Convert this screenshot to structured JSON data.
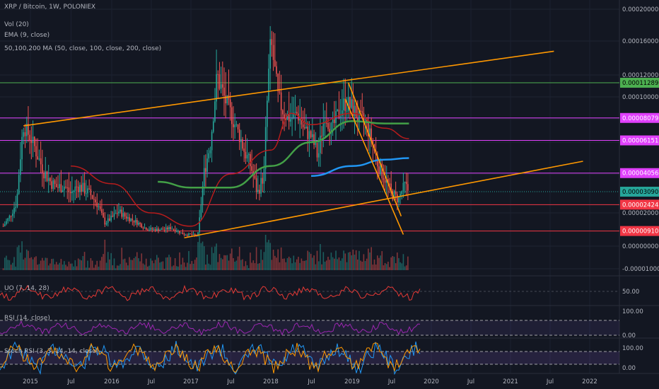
{
  "header": {
    "symbol_line": "XRP / Bitcoin, 1W, POLONIEX",
    "vol_label": "Vol (20)",
    "ema_label": "EMA (9, close)",
    "ma_label": "50,100,200 MA (50, close, 100, close, 200, close)"
  },
  "colors": {
    "background": "#131722",
    "candle_up": "#26a69a",
    "candle_down": "#ef5350",
    "trend_orange": "#ff9800",
    "ma50": "#b71c1c",
    "ma100": "#43a047",
    "ma200": "#2196f3",
    "hline_green": "#4caf50",
    "hline_magenta": "#e040fb",
    "hline_red": "#f23645",
    "osc_uo": "#e53935",
    "osc_rsi": "#9c27b0",
    "stoch_k": "#2196f3",
    "stoch_d": "#ff9800"
  },
  "chart_data": {
    "type": "candlestick",
    "x_range": [
      "2014-09-01",
      "2022-12-31"
    ],
    "y_range": [
      -1e-05,
      0.00021
    ],
    "price_axis_ticks": [
      "0.00020000",
      "0.00016000",
      "0.00012000",
      "0.00010000",
      "0.00008000",
      "0.00006000",
      "0.00004000",
      "0.00002000",
      "0.00000000",
      "-0.00001000"
    ],
    "time_axis_ticks": [
      "2015",
      "Jul",
      "2016",
      "Jul",
      "2017",
      "Jul",
      "2018",
      "Jul",
      "2019",
      "Jul",
      "2020",
      "Jul",
      "2021",
      "Jul",
      "2022"
    ],
    "horizontal_levels": [
      {
        "value": 0.00011289,
        "label": "0.00011289",
        "color": "green"
      },
      {
        "value": 8.079e-05,
        "label": "0.00008079",
        "color": "magenta"
      },
      {
        "value": 6.151e-05,
        "label": "0.00006151",
        "color": "magenta"
      },
      {
        "value": 4.056e-05,
        "label": "0.00004056",
        "color": "magenta"
      },
      {
        "value": 3.09e-05,
        "label": "0.00003090",
        "color": "last"
      },
      {
        "value": 2.424e-05,
        "label": "0.00002424",
        "color": "red"
      },
      {
        "value": 9.1e-06,
        "label": "0.00000910",
        "color": "red"
      }
    ],
    "price_series": [
      [
        "2014-09-01",
        1.2e-05
      ],
      [
        "2014-10-01",
        1.8e-05
      ],
      [
        "2014-11-01",
        2.6e-05
      ],
      [
        "2014-12-01",
        7.4e-05
      ],
      [
        "2015-01-01",
        6.4e-05
      ],
      [
        "2015-02-01",
        5.2e-05
      ],
      [
        "2015-03-01",
        4.2e-05
      ],
      [
        "2015-04-01",
        3.6e-05
      ],
      [
        "2015-05-01",
        3.3e-05
      ],
      [
        "2015-06-01",
        3.4e-05
      ],
      [
        "2015-07-01",
        3e-05
      ],
      [
        "2015-08-01",
        3.4e-05
      ],
      [
        "2015-09-01",
        3.2e-05
      ],
      [
        "2015-10-01",
        2.9e-05
      ],
      [
        "2015-11-01",
        2.4e-05
      ],
      [
        "2015-12-01",
        1.4e-05
      ],
      [
        "2016-01-01",
        1.7e-05
      ],
      [
        "2016-02-01",
        2.1e-05
      ],
      [
        "2016-03-01",
        1.8e-05
      ],
      [
        "2016-04-01",
        1.6e-05
      ],
      [
        "2016-05-01",
        1.4e-05
      ],
      [
        "2016-06-01",
        1.1e-05
      ],
      [
        "2016-07-01",
        1e-05
      ],
      [
        "2016-08-01",
        1e-05
      ],
      [
        "2016-09-01",
        1e-05
      ],
      [
        "2016-10-01",
        1.1e-05
      ],
      [
        "2016-11-01",
        9e-06
      ],
      [
        "2016-12-01",
        7e-06
      ],
      [
        "2017-01-01",
        7e-06
      ],
      [
        "2017-02-01",
        6e-06
      ],
      [
        "2017-03-01",
        4e-05
      ],
      [
        "2017-04-01",
        6e-05
      ],
      [
        "2017-05-01",
        0.00012
      ],
      [
        "2017-06-01",
        0.0001
      ],
      [
        "2017-07-01",
        8.5e-05
      ],
      [
        "2017-08-01",
        7e-05
      ],
      [
        "2017-09-01",
        5.5e-05
      ],
      [
        "2017-10-01",
        4.5e-05
      ],
      [
        "2017-11-01",
        3e-05
      ],
      [
        "2017-12-01",
        4e-05
      ],
      [
        "2018-01-01",
        0.00016
      ],
      [
        "2018-02-01",
        0.0001
      ],
      [
        "2018-03-01",
        8.5e-05
      ],
      [
        "2018-04-01",
        8e-05
      ],
      [
        "2018-05-01",
        8.5e-05
      ],
      [
        "2018-06-01",
        7e-05
      ],
      [
        "2018-07-01",
        6.5e-05
      ],
      [
        "2018-08-01",
        5e-05
      ],
      [
        "2018-09-01",
        8.5e-05
      ],
      [
        "2018-10-01",
        7e-05
      ],
      [
        "2018-11-01",
        8.5e-05
      ],
      [
        "2018-12-01",
        9.5e-05
      ],
      [
        "2019-01-01",
        9e-05
      ],
      [
        "2019-02-01",
        8e-05
      ],
      [
        "2019-03-01",
        7.8e-05
      ],
      [
        "2019-04-01",
        6.2e-05
      ],
      [
        "2019-05-01",
        4.5e-05
      ],
      [
        "2019-06-01",
        3.8e-05
      ],
      [
        "2019-07-01",
        3e-05
      ],
      [
        "2019-08-01",
        2.7e-05
      ],
      [
        "2019-09-01",
        3.4e-05
      ],
      [
        "2019-09-20",
        3.09e-05
      ]
    ],
    "ma50": [
      [
        "2015-07-01",
        4.5e-05
      ],
      [
        "2016-01-01",
        3.5e-05
      ],
      [
        "2016-07-01",
        2e-05
      ],
      [
        "2017-01-01",
        1.2e-05
      ],
      [
        "2017-07-01",
        4e-05
      ],
      [
        "2018-01-01",
        5.5e-05
      ],
      [
        "2018-04-01",
        8.5e-05
      ],
      [
        "2018-07-01",
        7.5e-05
      ],
      [
        "2019-01-01",
        8.5e-05
      ],
      [
        "2019-06-01",
        7.2e-05
      ],
      [
        "2019-09-20",
        6.3e-05
      ]
    ],
    "ma100": [
      [
        "2016-08-01",
        3.6e-05
      ],
      [
        "2017-01-01",
        3.3e-05
      ],
      [
        "2017-07-01",
        3.3e-05
      ],
      [
        "2018-01-01",
        4.5e-05
      ],
      [
        "2018-07-01",
        6e-05
      ],
      [
        "2019-01-01",
        7.8e-05
      ],
      [
        "2019-06-01",
        7.6e-05
      ],
      [
        "2019-09-20",
        7.6e-05
      ]
    ],
    "ma200": [
      [
        "2018-07-01",
        3.9e-05
      ],
      [
        "2019-01-01",
        4.5e-05
      ],
      [
        "2019-06-01",
        4.9e-05
      ],
      [
        "2019-09-20",
        5e-05
      ]
    ],
    "oscillators": [
      {
        "label": "UO (7, 14, 28)",
        "scale_ticks": [
          "50.00"
        ]
      },
      {
        "label": "RSI (14, close)",
        "scale_ticks": [
          "100.00",
          "0.00"
        ]
      },
      {
        "label": "Stoch RSI (3, 3, 14, 14, close)",
        "scale_ticks": [
          "100.00",
          "0.00"
        ]
      }
    ]
  }
}
